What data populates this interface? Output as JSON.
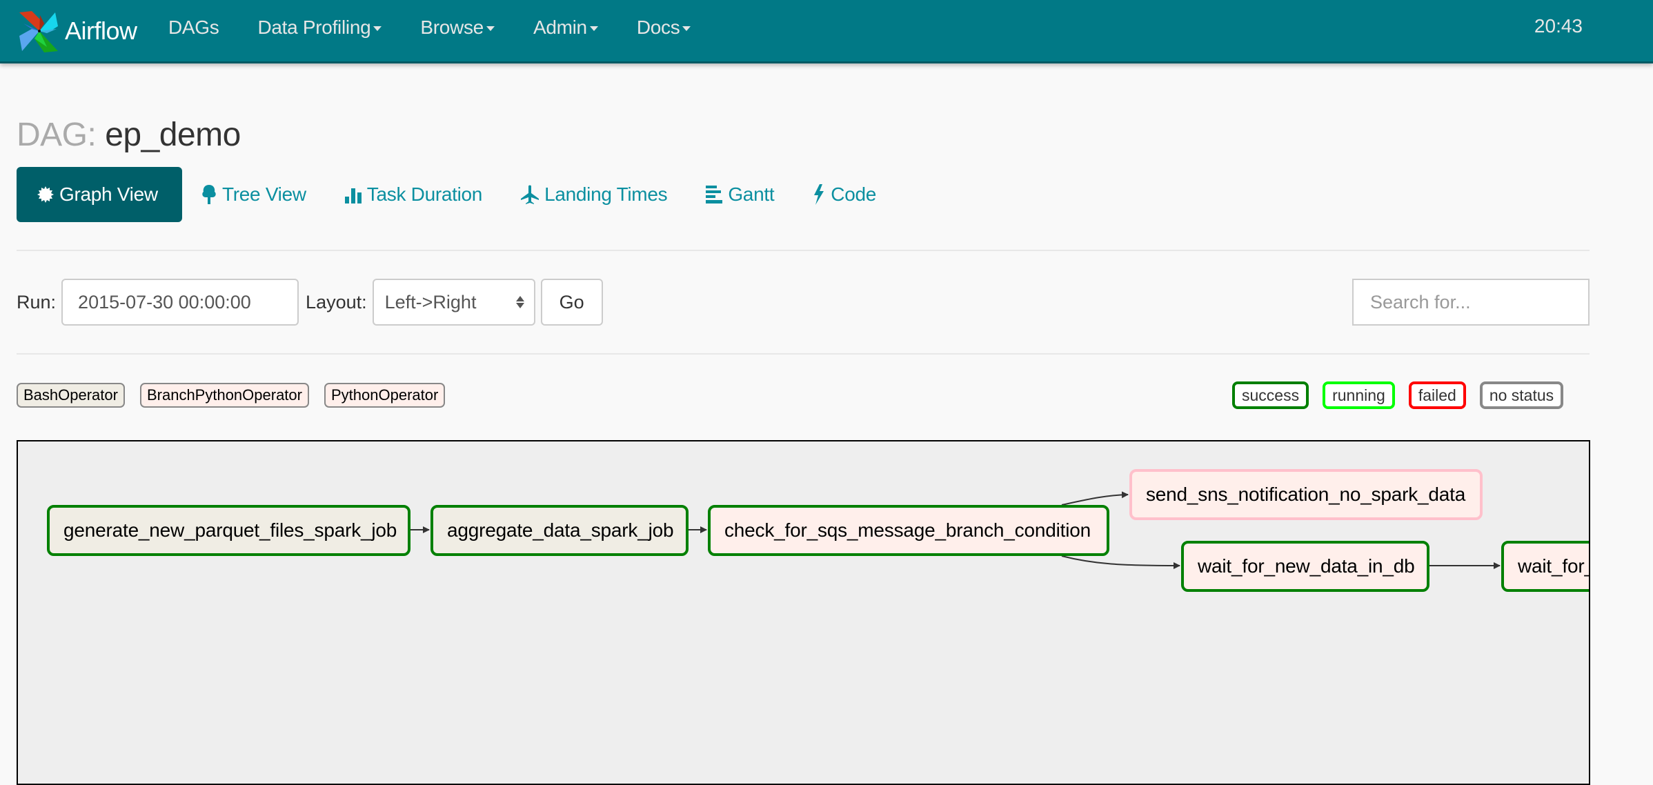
{
  "navbar": {
    "brand": "Airflow",
    "items": [
      {
        "label": "DAGs",
        "dropdown": false
      },
      {
        "label": "Data Profiling",
        "dropdown": true
      },
      {
        "label": "Browse",
        "dropdown": true
      },
      {
        "label": "Admin",
        "dropdown": true
      },
      {
        "label": "Docs",
        "dropdown": true
      }
    ],
    "clock": "20:43"
  },
  "page": {
    "title_prefix": "DAG:",
    "dag_id": "ep_demo"
  },
  "tabs": [
    {
      "label": "Graph View",
      "icon": "certificate-icon",
      "active": true
    },
    {
      "label": "Tree View",
      "icon": "tree-icon",
      "active": false
    },
    {
      "label": "Task Duration",
      "icon": "bar-chart-icon",
      "active": false
    },
    {
      "label": "Landing Times",
      "icon": "plane-icon",
      "active": false
    },
    {
      "label": "Gantt",
      "icon": "align-left-icon",
      "active": false
    },
    {
      "label": "Code",
      "icon": "flash-icon",
      "active": false
    }
  ],
  "controls": {
    "run_label": "Run:",
    "run_value": "2015-07-30 00:00:00",
    "layout_label": "Layout:",
    "layout_value": "Left->Right",
    "go_label": "Go",
    "search_placeholder": "Search for..."
  },
  "operators": [
    {
      "label": "BashOperator",
      "color": "#f0ede4"
    },
    {
      "label": "BranchPythonOperator",
      "color": "#ffefeb"
    },
    {
      "label": "PythonOperator",
      "color": "#ffefeb"
    }
  ],
  "statuses": [
    {
      "label": "success",
      "color": "#008000"
    },
    {
      "label": "running",
      "color": "#00ff00"
    },
    {
      "label": "failed",
      "color": "#ff0000"
    },
    {
      "label": "no status",
      "color": "#888888"
    }
  ],
  "graph": {
    "nodes": [
      {
        "id": "generate_new_parquet_files_spark_job",
        "label": "generate_new_parquet_files_spark_job",
        "operator": "BashOperator",
        "state": "success"
      },
      {
        "id": "aggregate_data_spark_job",
        "label": "aggregate_data_spark_job",
        "operator": "BashOperator",
        "state": "success"
      },
      {
        "id": "check_for_sqs_message_branch_condition",
        "label": "check_for_sqs_message_branch_condition",
        "operator": "BranchPythonOperator",
        "state": "success"
      },
      {
        "id": "send_sns_notification_no_spark_data",
        "label": "send_sns_notification_no_spark_data",
        "operator": "PythonOperator",
        "state": "skipped"
      },
      {
        "id": "wait_for_new_data_in_db",
        "label": "wait_for_new_data_in_db",
        "operator": "PythonOperator",
        "state": "success"
      },
      {
        "id": "wait_for_",
        "label": "wait_for_",
        "operator": "PythonOperator",
        "state": "success"
      }
    ],
    "edges": [
      [
        "generate_new_parquet_files_spark_job",
        "aggregate_data_spark_job"
      ],
      [
        "aggregate_data_spark_job",
        "check_for_sqs_message_branch_condition"
      ],
      [
        "check_for_sqs_message_branch_condition",
        "send_sns_notification_no_spark_data"
      ],
      [
        "check_for_sqs_message_branch_condition",
        "wait_for_new_data_in_db"
      ],
      [
        "wait_for_new_data_in_db",
        "wait_for_"
      ]
    ],
    "state_colors": {
      "success": "#008000",
      "skipped": "#ffc0cb"
    },
    "operator_colors": {
      "BashOperator": "#f0ede4",
      "BranchPythonOperator": "#ffefeb",
      "PythonOperator": "#ffefeb"
    }
  }
}
